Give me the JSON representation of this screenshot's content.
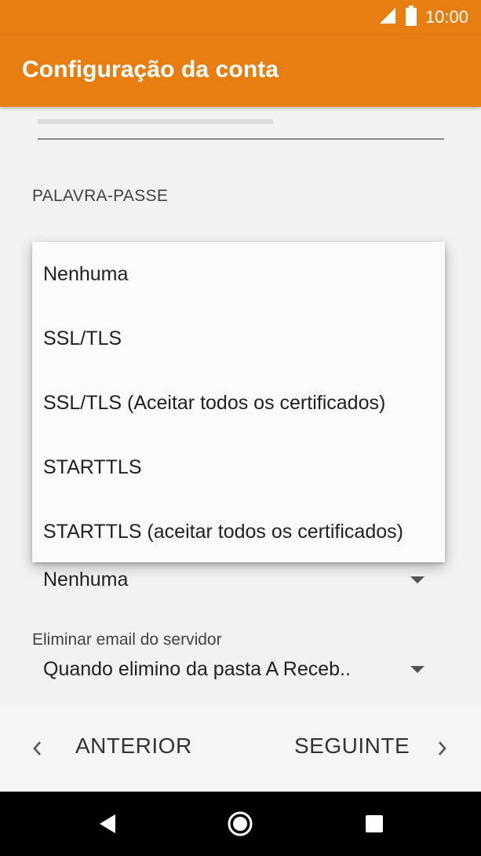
{
  "status_bar": {
    "time": "10:00",
    "icons": [
      "signal-icon",
      "battery-icon"
    ]
  },
  "app_bar": {
    "title": "Configuração da conta"
  },
  "form": {
    "password_label": "PALAVRA-PASSE",
    "security_value": "Nenhuma",
    "delete_label": "Eliminar email do servidor",
    "delete_value": "Quando elimino da pasta A Receb.."
  },
  "dropdown": {
    "options": [
      "Nenhuma",
      "SSL/TLS",
      "SSL/TLS (Aceitar todos os certificados)",
      "STARTTLS",
      "STARTTLS (aceitar todos os certificados)"
    ]
  },
  "bottom_nav": {
    "previous_label": "ANTERIOR",
    "next_label": "SEGUINTE"
  },
  "colors": {
    "accent": "#e67e12",
    "background": "#f2f2f2",
    "system_nav": "#000000"
  },
  "system_nav": {
    "icons": [
      "back-icon",
      "home-icon",
      "recents-icon"
    ]
  }
}
